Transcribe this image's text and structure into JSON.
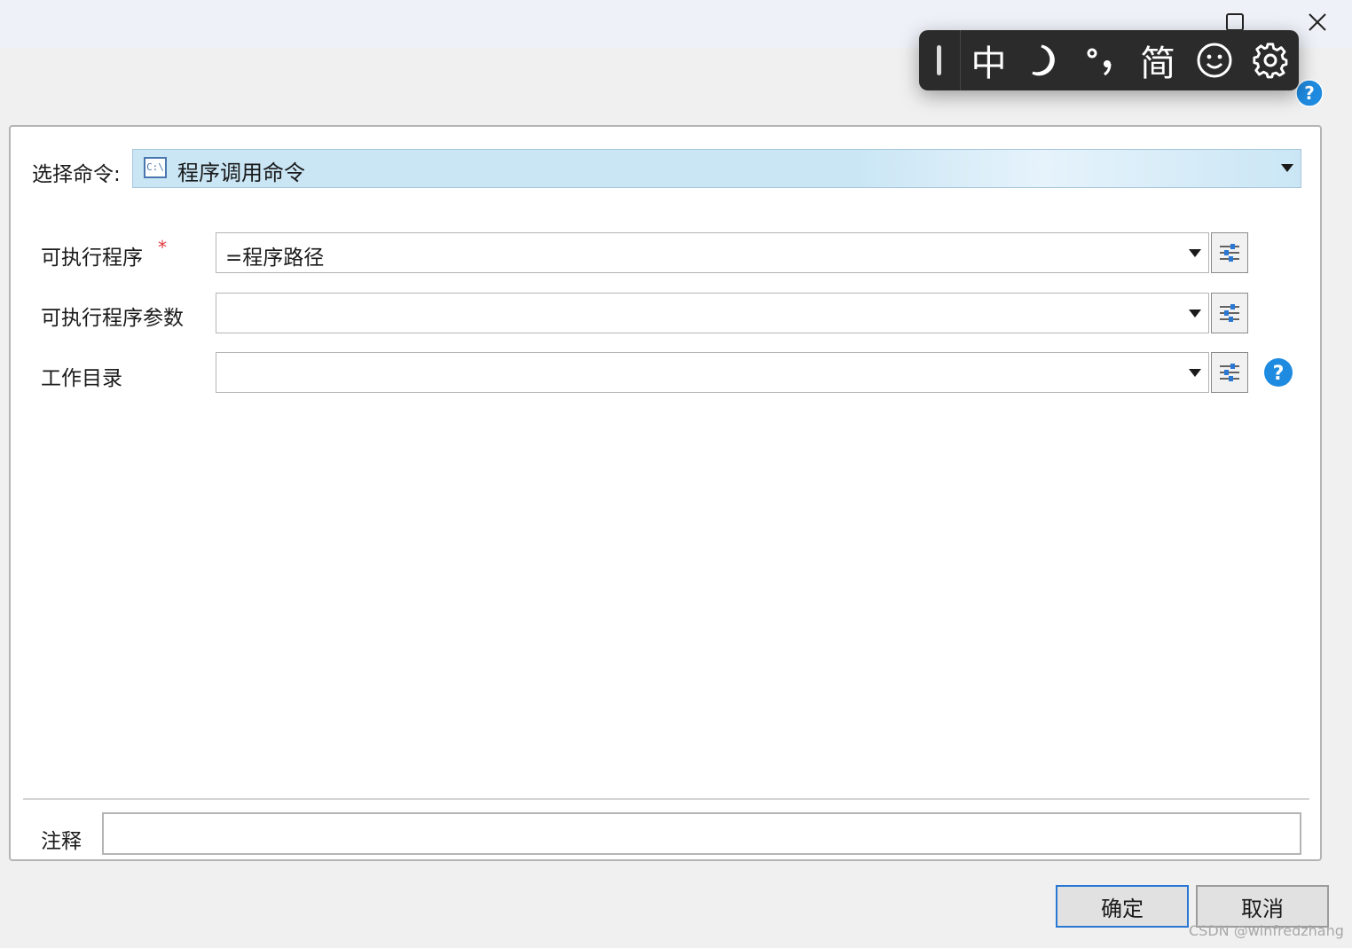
{
  "window": {
    "controls": [
      "minimize-icon",
      "maximize-icon",
      "close-icon"
    ]
  },
  "ime_toolbar": {
    "mode": "中",
    "width_label": "☽",
    "punct_label": "°,",
    "script_label": "简",
    "icons": [
      "moon-icon",
      "punctuation-icon",
      "smiley-icon",
      "gear-icon"
    ]
  },
  "form": {
    "command_label": "选择命令:",
    "command_icon_text": "C:\\",
    "command_value": "程序调用命令",
    "required_mark": "*",
    "fields": [
      {
        "label": "可执行程序",
        "value": "=程序路径",
        "required": true
      },
      {
        "label": "可执行程序参数",
        "value": ""
      },
      {
        "label": "工作目录",
        "value": ""
      }
    ],
    "comment_label": "注释",
    "comment_value": ""
  },
  "buttons": {
    "ok": "确定",
    "cancel": "取消"
  },
  "watermark": "CSDN @winfredzhang",
  "colors": {
    "accent": "#2b78d4",
    "required": "#e0393e",
    "help": "#1f8be0",
    "selection": "#cae6f5"
  }
}
